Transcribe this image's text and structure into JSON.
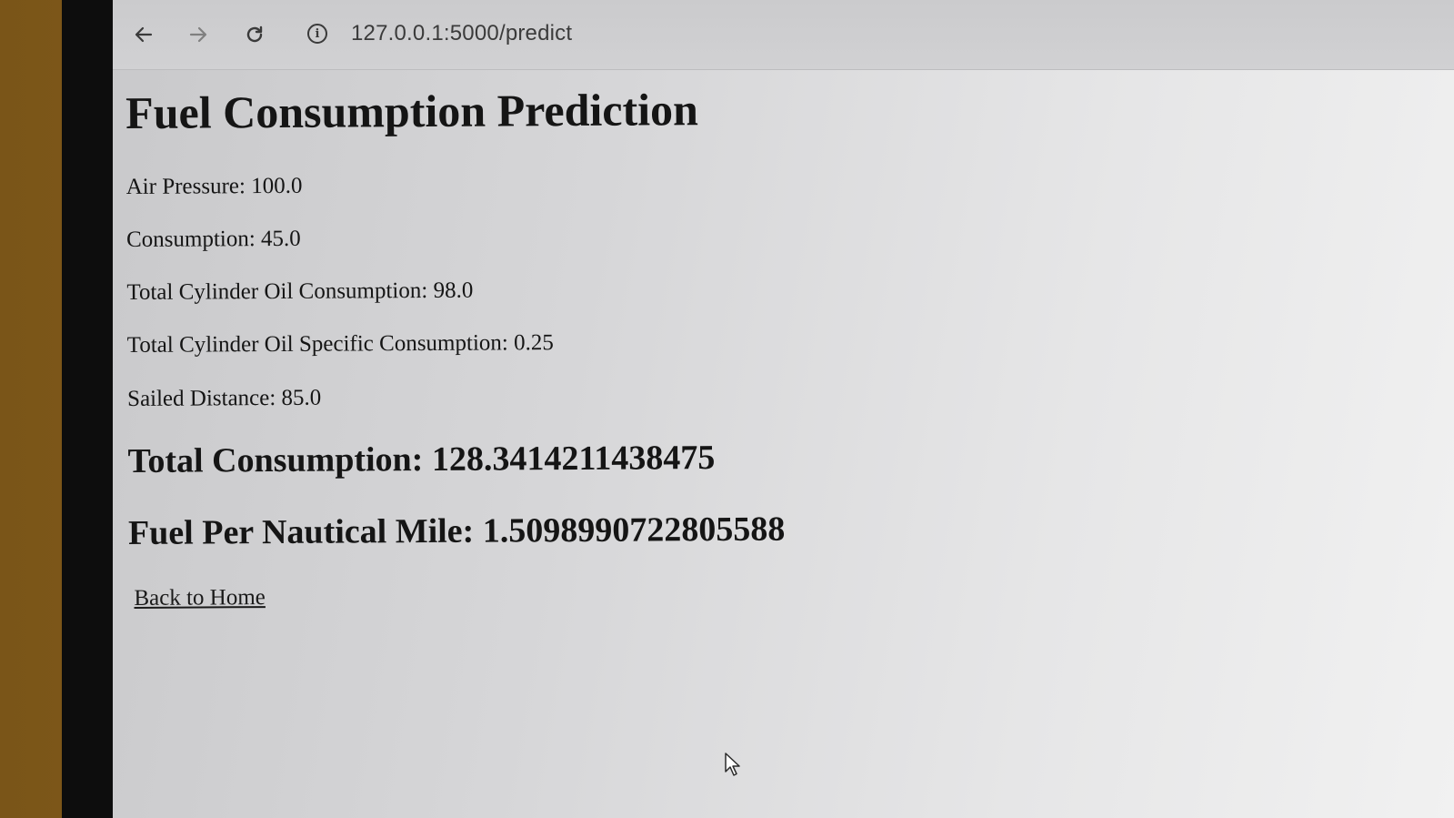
{
  "browser": {
    "url": "127.0.0.1:5000/predict",
    "back_icon": "arrow-left-icon",
    "forward_icon": "arrow-right-icon",
    "reload_icon": "reload-icon",
    "site_info_icon": "info-icon"
  },
  "page": {
    "title": "Fuel Consumption Prediction",
    "fields": [
      "Air Pressure: 100.0",
      "Consumption: 45.0",
      "Total Cylinder Oil Consumption: 98.0",
      "Total Cylinder Oil Specific Consumption: 0.25",
      "Sailed Distance: 85.0"
    ],
    "total_consumption": "Total Consumption: 128.3414211438475",
    "fuel_per_mile": "Fuel Per Nautical Mile: 1.5098990722805588",
    "back_link": "Back to Home"
  }
}
